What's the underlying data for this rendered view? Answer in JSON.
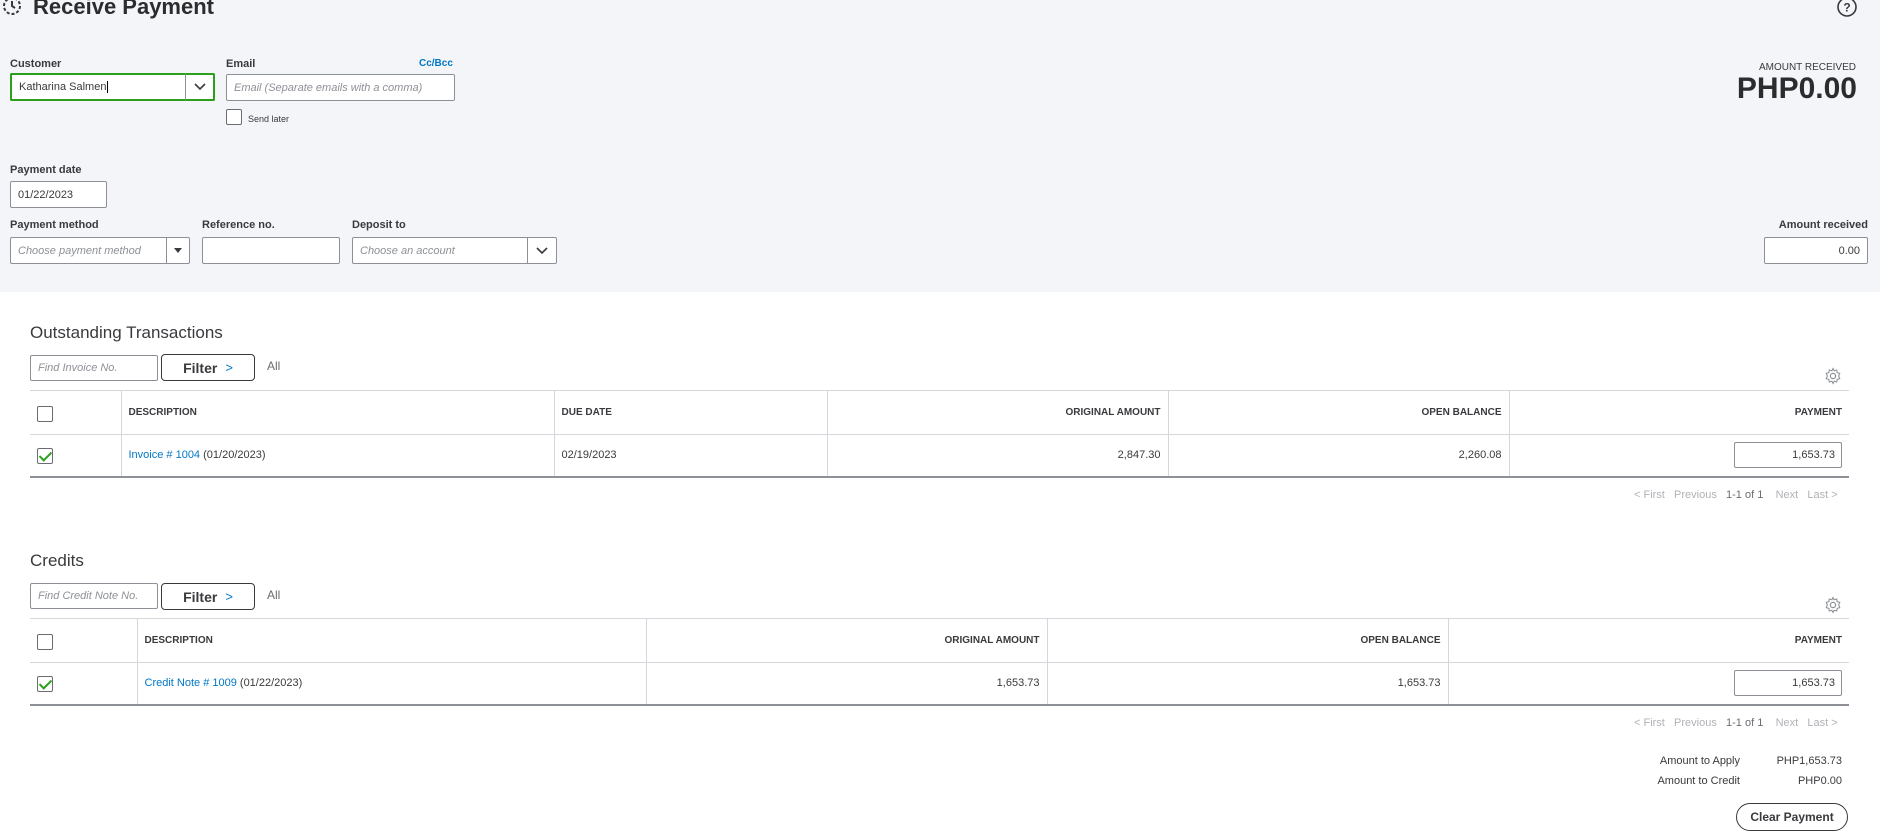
{
  "header": {
    "title": "Receive Payment",
    "help_icon": "help-circle-icon",
    "history_icon": "history-icon"
  },
  "customer": {
    "label": "Customer",
    "value": "Katharina Salmen"
  },
  "email": {
    "label": "Email",
    "cc_bcc": "Cc/Bcc",
    "placeholder": "Email (Separate emails with a comma)",
    "send_later": "Send later"
  },
  "amount_received_header": {
    "label": "AMOUNT RECEIVED",
    "value": "PHP0.00"
  },
  "payment_date": {
    "label": "Payment date",
    "value": "01/22/2023"
  },
  "payment_method": {
    "label": "Payment method",
    "placeholder": "Choose payment method"
  },
  "reference": {
    "label": "Reference no.",
    "value": ""
  },
  "deposit_to": {
    "label": "Deposit to",
    "placeholder": "Choose an account"
  },
  "amount_received_field": {
    "label": "Amount received",
    "value": "0.00"
  },
  "outstanding": {
    "title": "Outstanding Transactions",
    "search_placeholder": "Find Invoice No.",
    "filter_label": "Filter",
    "all_label": "All",
    "columns": [
      "DESCRIPTION",
      "DUE DATE",
      "ORIGINAL AMOUNT",
      "OPEN BALANCE",
      "PAYMENT"
    ],
    "rows": [
      {
        "checked": true,
        "link": "Invoice # 1004",
        "date": "(01/20/2023)",
        "due_date": "02/19/2023",
        "original_amount": "2,847.30",
        "open_balance": "2,260.08",
        "payment": "1,653.73"
      }
    ],
    "pager": {
      "first": "< First",
      "previous": "Previous",
      "range": "1-1 of 1",
      "next": "Next",
      "last": "Last >"
    }
  },
  "credits": {
    "title": "Credits",
    "search_placeholder": "Find Credit Note No.",
    "filter_label": "Filter",
    "all_label": "All",
    "columns": [
      "DESCRIPTION",
      "ORIGINAL AMOUNT",
      "OPEN BALANCE",
      "PAYMENT"
    ],
    "rows": [
      {
        "checked": true,
        "link": "Credit Note # 1009",
        "date": "(01/22/2023)",
        "original_amount": "1,653.73",
        "open_balance": "1,653.73",
        "payment": "1,653.73"
      }
    ],
    "pager": {
      "first": "< First",
      "previous": "Previous",
      "range": "1-1 of 1",
      "next": "Next",
      "last": "Last >"
    }
  },
  "summary": {
    "apply_label": "Amount to Apply",
    "apply_value": "PHP1,653.73",
    "credit_label": "Amount to Credit",
    "credit_value": "PHP0.00",
    "clear_button": "Clear Payment"
  },
  "colors": {
    "accent_green": "#2ca01c",
    "link_blue": "#0077c5",
    "header_bg": "#f4f5f8"
  }
}
